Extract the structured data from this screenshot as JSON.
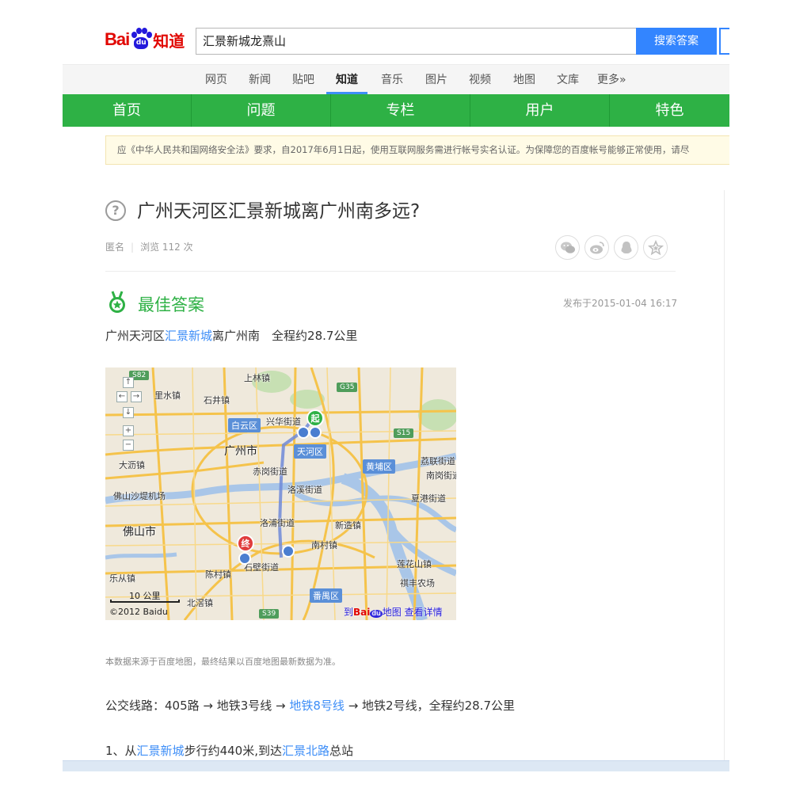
{
  "header": {
    "logo_text_bai": "Bai",
    "logo_text_du": "du",
    "logo_text_zhidao": "知道",
    "search_value": "汇景新城龙熹山",
    "search_button": "搜索答案"
  },
  "catnav": {
    "items": [
      {
        "label": "网页"
      },
      {
        "label": "新闻"
      },
      {
        "label": "贴吧"
      },
      {
        "label": "知道"
      },
      {
        "label": "音乐"
      },
      {
        "label": "图片"
      },
      {
        "label": "视频"
      },
      {
        "label": "地图"
      },
      {
        "label": "文库"
      },
      {
        "label": "更多»"
      }
    ],
    "active": "知道"
  },
  "greenbar": {
    "items": [
      {
        "label": "首页"
      },
      {
        "label": "问题"
      },
      {
        "label": "专栏"
      },
      {
        "label": "用户"
      },
      {
        "label": "特色"
      }
    ]
  },
  "notice": "应《中华人民共和国网络安全法》要求，自2017年6月1日起，使用互联网服务需进行帐号实名认证。为保障您的百度帐号能够正常使用，请尽",
  "question": {
    "icon": "?",
    "title": "广州天河区汇景新城离广州南多远?",
    "author": "匿名",
    "views": "浏览 112 次"
  },
  "share_icons": [
    "wechat-icon",
    "weibo-icon",
    "qq-icon",
    "favorite-star-icon"
  ],
  "best_answer": {
    "title": "最佳答案",
    "published": "发布于2015-01-04 16:17",
    "summary_pre": "广州天河区",
    "summary_link": "汇景新城",
    "summary_post": "离广州南　全程约28.7公里",
    "source_note": "本数据来源于百度地图，最终结果以百度地图最新数据为准。",
    "route_pre": "公交线路：405路 → 地铁3号线 → ",
    "route_link": "地铁8号线",
    "route_post": " → 地铁2号线，全程约28.7公里",
    "step1_pre": "1、从",
    "step1_link1": "汇景新城",
    "step1_mid": "步行约440米,到达",
    "step1_link2": "汇景北路",
    "step1_post": "总站"
  },
  "map": {
    "labels": {
      "shanglinzhen": "上林镇",
      "lishuizhen": "里水镇",
      "shijingzhen": "石井镇",
      "baiyunqu": "白云区",
      "xinghuajiedao": "兴华街道",
      "guangzhoushi": "广州市",
      "tianhequ": "天河区",
      "huangpuqu": "黄埔区",
      "lihu": "荔联街道",
      "nangang": "南岗街道",
      "dali": "大沥镇",
      "chisha": "赤岗街道",
      "foshanshaduan": "佛山沙堤机场",
      "luozhou": "洛溪街道",
      "xiagang": "夏港街道",
      "luopu": "洛浦街道",
      "xinzao": "新造镇",
      "foshanshi": "佛山市",
      "nancun": "南村镇",
      "shibi": "石壁街道",
      "lianhuashan": "莲花山镇",
      "lecong": "乐从镇",
      "chencun": "陈村镇",
      "qisha": "祺丰农场",
      "panyuqu": "番禺区",
      "beijiao": "北滘镇",
      "g35": "G35",
      "s15": "S15",
      "s39": "S39",
      "s82": "S82"
    },
    "start_marker": "起",
    "end_marker": "终",
    "scale": "10 公里",
    "copyright": "©2012 Baidu",
    "to_prefix": "到",
    "to_baidu": "Bai",
    "to_du": "du",
    "to_suffix": "地图 查看详情",
    "controls": [
      "↑",
      "←",
      "→",
      "↓",
      "+",
      "−"
    ]
  }
}
